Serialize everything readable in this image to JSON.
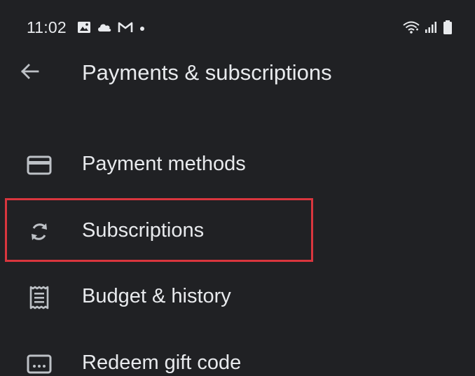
{
  "status_bar": {
    "time": "11:02",
    "left_icons": [
      "image-icon",
      "cloud-icon",
      "gmail-icon",
      "dot-icon"
    ],
    "right_icons": [
      "wifi-icon",
      "signal-icon",
      "battery-icon"
    ]
  },
  "app_bar": {
    "back_icon": "arrow-back-icon",
    "title": "Payments & subscriptions"
  },
  "menu": {
    "items": [
      {
        "label": "Payment methods",
        "icon": "credit-card-icon"
      },
      {
        "label": "Subscriptions",
        "icon": "sync-icon"
      },
      {
        "label": "Budget & history",
        "icon": "receipt-icon"
      },
      {
        "label": "Redeem gift code",
        "icon": "gift-code-icon"
      }
    ]
  },
  "colors": {
    "background": "#202124",
    "text": "#e8eaed",
    "icon": "#bdc1c6",
    "highlight": "#d9363e"
  }
}
